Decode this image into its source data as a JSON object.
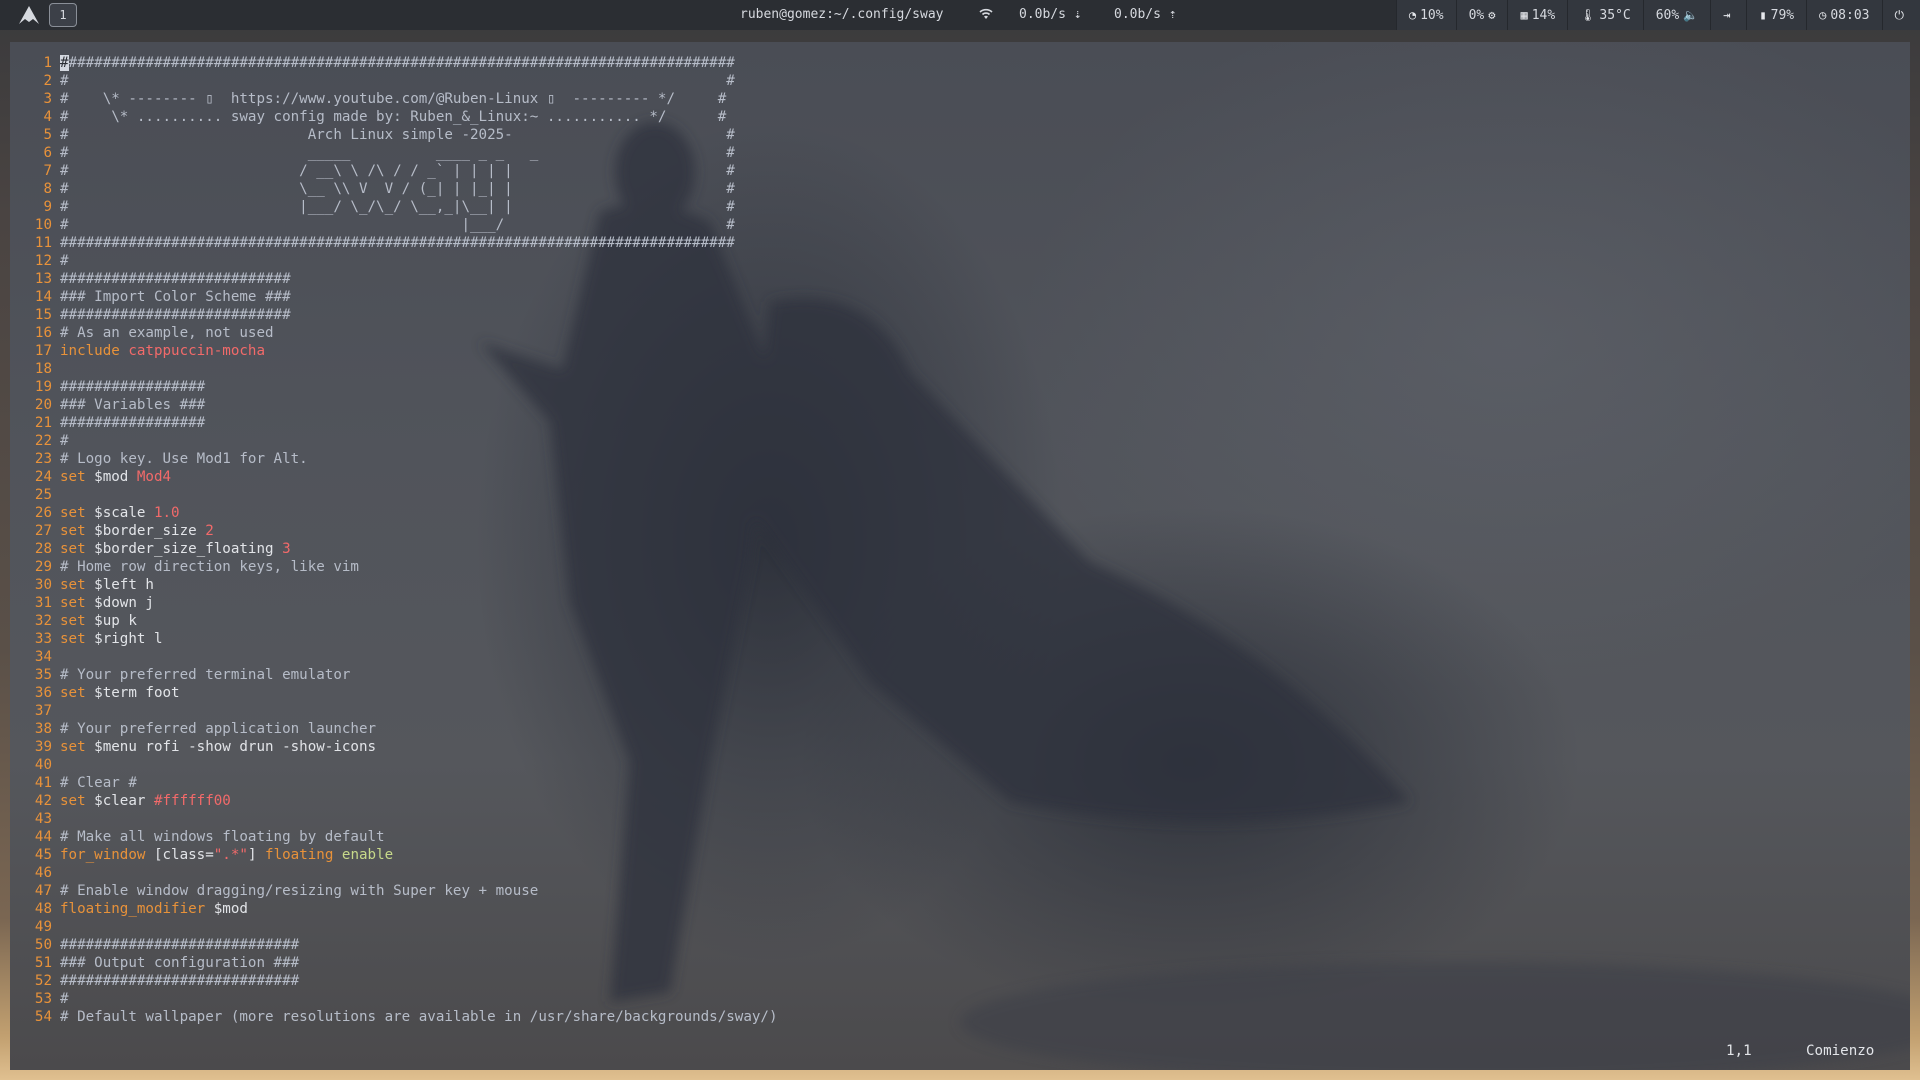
{
  "topbar": {
    "workspace": "1",
    "title": "ruben@gomez:~/.config/sway",
    "wifi_icon": "wifi-icon",
    "net_down": "0.0b/s",
    "net_up": "0.0b/s",
    "modules": [
      {
        "name": "cpu",
        "icon": "◔",
        "text": "10%"
      },
      {
        "name": "gpu",
        "icon": "⚙",
        "text": "0%"
      },
      {
        "name": "memory",
        "icon": "▦",
        "text": "14%"
      },
      {
        "name": "temperature",
        "icon": "🌡",
        "text": "35°C"
      },
      {
        "name": "volume",
        "icon": "🔈",
        "text": "60%"
      },
      {
        "name": "logout",
        "icon": "⇥",
        "text": ""
      },
      {
        "name": "battery",
        "icon": "▮",
        "text": "79%"
      },
      {
        "name": "clock",
        "icon": "◷",
        "text": "08:03"
      },
      {
        "name": "power",
        "icon": "⏻",
        "text": ""
      }
    ]
  },
  "editor": {
    "lines": [
      [
        [
          "#",
          "cursor"
        ],
        [
          "##############################################################################",
          "c-comment"
        ]
      ],
      [
        [
          "#                                                                             #",
          "c-comment"
        ]
      ],
      [
        [
          "#    \\* -------- ▯  https://www.youtube.com/@Ruben-Linux ▯  --------- */     #",
          "c-comment"
        ]
      ],
      [
        [
          "#     \\* .......... sway config made by: Ruben_&_Linux:~ ........... */      #",
          "c-comment"
        ]
      ],
      [
        [
          "#                            Arch Linux simple -2025-                         #",
          "c-comment"
        ]
      ],
      [
        [
          "#                            _____          ____ _ _   _                      #",
          "c-comment"
        ]
      ],
      [
        [
          "#                           / __\\ \\ /\\ / / _` | | | |                         #",
          "c-comment"
        ]
      ],
      [
        [
          "#                           \\__ \\\\ V  V / (_| | |_| |                         #",
          "c-comment"
        ]
      ],
      [
        [
          "#                           |___/ \\_/\\_/ \\__,_|\\__| |                         #",
          "c-comment"
        ]
      ],
      [
        [
          "#                                              |___/                          #",
          "c-comment"
        ]
      ],
      [
        [
          "###############################################################################",
          "c-comment"
        ]
      ],
      [
        [
          "#",
          "c-comment"
        ]
      ],
      [
        [
          "###########################",
          "c-comment"
        ]
      ],
      [
        [
          "### Import Color Scheme ###",
          "c-comment"
        ]
      ],
      [
        [
          "###########################",
          "c-comment"
        ]
      ],
      [
        [
          "# As an example, not used",
          "c-comment"
        ]
      ],
      [
        [
          "include ",
          "c-kw"
        ],
        [
          "catppuccin-mocha",
          "c-str"
        ]
      ],
      [],
      [
        [
          "#################",
          "c-comment"
        ]
      ],
      [
        [
          "### Variables ###",
          "c-comment"
        ]
      ],
      [
        [
          "#################",
          "c-comment"
        ]
      ],
      [
        [
          "#",
          "c-comment"
        ]
      ],
      [
        [
          "# Logo key. Use Mod1 for Alt.",
          "c-comment"
        ]
      ],
      [
        [
          "set ",
          "c-kw"
        ],
        [
          "$mod ",
          "c-norm"
        ],
        [
          "Mod4",
          "c-val"
        ]
      ],
      [],
      [
        [
          "set ",
          "c-kw"
        ],
        [
          "$scale ",
          "c-norm"
        ],
        [
          "1.0",
          "c-val"
        ]
      ],
      [
        [
          "set ",
          "c-kw"
        ],
        [
          "$border_size ",
          "c-norm"
        ],
        [
          "2",
          "c-val"
        ]
      ],
      [
        [
          "set ",
          "c-kw"
        ],
        [
          "$border_size_floating ",
          "c-norm"
        ],
        [
          "3",
          "c-val"
        ]
      ],
      [
        [
          "# Home row direction keys, like vim",
          "c-comment"
        ]
      ],
      [
        [
          "set ",
          "c-kw"
        ],
        [
          "$left h",
          "c-norm"
        ]
      ],
      [
        [
          "set ",
          "c-kw"
        ],
        [
          "$down j",
          "c-norm"
        ]
      ],
      [
        [
          "set ",
          "c-kw"
        ],
        [
          "$up k",
          "c-norm"
        ]
      ],
      [
        [
          "set ",
          "c-kw"
        ],
        [
          "$right l",
          "c-norm"
        ]
      ],
      [],
      [
        [
          "# Your preferred terminal emulator",
          "c-comment"
        ]
      ],
      [
        [
          "set ",
          "c-kw"
        ],
        [
          "$term foot",
          "c-norm"
        ]
      ],
      [],
      [
        [
          "# Your preferred application launcher",
          "c-comment"
        ]
      ],
      [
        [
          "set ",
          "c-kw"
        ],
        [
          "$menu rofi -show drun -show-icons",
          "c-norm"
        ]
      ],
      [],
      [
        [
          "# Clear #",
          "c-comment"
        ]
      ],
      [
        [
          "set ",
          "c-kw"
        ],
        [
          "$clear ",
          "c-norm"
        ],
        [
          "#ffffff00",
          "c-val"
        ]
      ],
      [],
      [
        [
          "# Make all windows floating by default",
          "c-comment"
        ]
      ],
      [
        [
          "for_window ",
          "c-kw"
        ],
        [
          "[class=",
          "c-norm"
        ],
        [
          "\".*\"",
          "c-str"
        ],
        [
          "] ",
          "c-norm"
        ],
        [
          "floating ",
          "c-kw"
        ],
        [
          "enable",
          "c-green"
        ]
      ],
      [],
      [
        [
          "# Enable window dragging/resizing with Super key + mouse",
          "c-comment"
        ]
      ],
      [
        [
          "floating_modifier ",
          "c-kw"
        ],
        [
          "$mod",
          "c-norm"
        ]
      ],
      [],
      [
        [
          "############################",
          "c-comment"
        ]
      ],
      [
        [
          "### Output configuration ###",
          "c-comment"
        ]
      ],
      [
        [
          "############################",
          "c-comment"
        ]
      ],
      [
        [
          "#",
          "c-comment"
        ]
      ],
      [
        [
          "# Default wallpaper (more resolutions are available in /usr/share/backgrounds/sway/)",
          "c-comment"
        ]
      ]
    ],
    "status_position": "1,1",
    "status_mode": "Comienzo"
  }
}
